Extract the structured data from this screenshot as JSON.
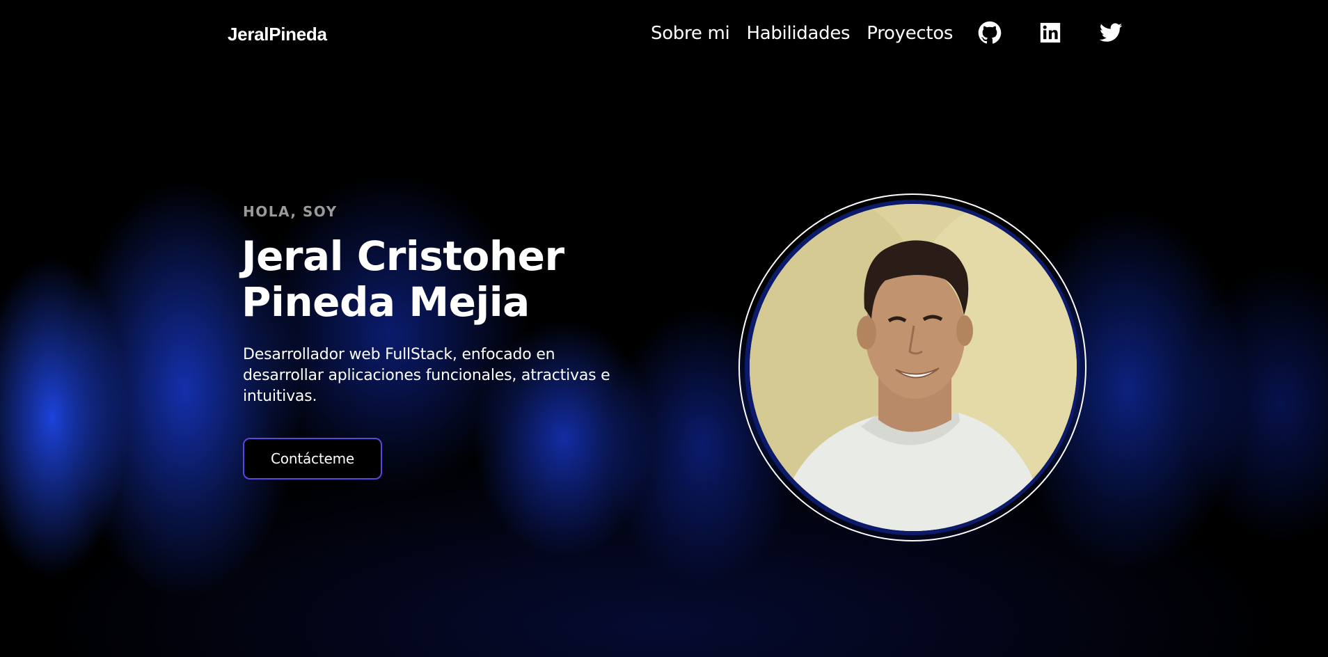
{
  "nav": {
    "logo": "JeralPineda",
    "links": [
      "Sobre mi",
      "Habilidades",
      "Proyectos"
    ],
    "social": [
      {
        "icon": "github-icon"
      },
      {
        "icon": "linkedin-icon"
      },
      {
        "icon": "twitter-icon"
      }
    ]
  },
  "hero": {
    "eyebrow": "HOLA, SOY",
    "name_line1": "Jeral Cristoher",
    "name_line2": "Pineda Mejia",
    "description": "Desarrollador web FullStack, enfocado en desarrollar aplicaciones funcionales, atractivas e intuitivas.",
    "cta_label": "Contácteme",
    "avatar_icon": "profile-photo"
  },
  "colors": {
    "background": "#000000",
    "glow": "#1e46e6",
    "cta_border": "#5b46e0",
    "eyebrow": "#9a9a9a",
    "avatar_frame": "#0b1a6b"
  }
}
